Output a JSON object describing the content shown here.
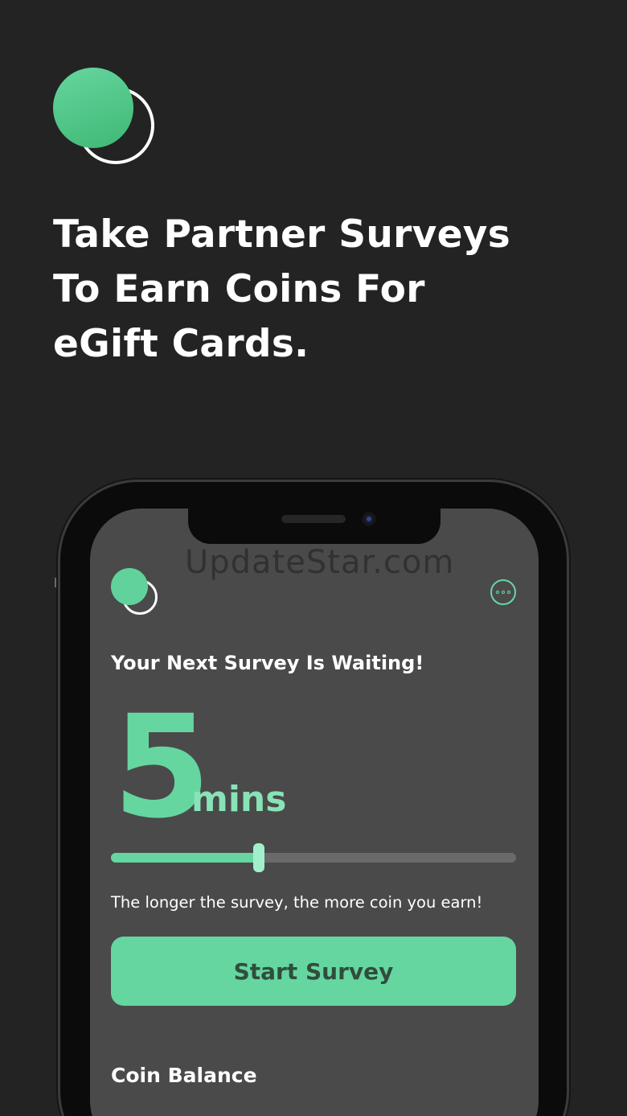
{
  "headline": {
    "lines": [
      "Take Partner Surveys",
      "To Earn Coins For",
      "eGift Cards."
    ]
  },
  "watermark": "UpdateStar.com",
  "app": {
    "menu_icon": "more-dots-icon",
    "subtitle": "Your Next Survey Is Waiting!",
    "duration_value": "5",
    "duration_unit": "mins",
    "slider_level": 0.365,
    "hint": "The longer the survey, the more coin you earn!",
    "start_label": "Start Survey",
    "coin_balance_label": "Coin Balance"
  },
  "colors": {
    "background": "#232323",
    "screen": "#4a4a4a",
    "accent": "#66d6a0",
    "button_text": "#2f4d3d"
  }
}
